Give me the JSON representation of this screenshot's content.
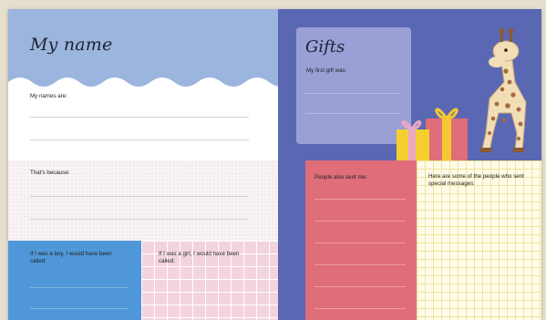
{
  "left_page": {
    "title": "My name",
    "names_label": "My names are:",
    "because_label": "That's because:",
    "boy_label": "If I was a boy, I would have been called:",
    "girl_label": "If I was a girl, I would have been called:"
  },
  "right_page": {
    "title": "Gifts",
    "first_gift_label": "My first gift was:",
    "also_sent_label": "People also sent me:",
    "messages_label": "Here are some of the people who sent special messages:"
  },
  "colors": {
    "header_blue": "#9bb5de",
    "right_bg": "#5a67b3",
    "card_lavender": "#9a9fd6",
    "pink_red": "#e06d7a",
    "blue_box": "#4f97d8",
    "grid_pink": "#f3d3dc",
    "grid_yellow": "#fffbe9"
  },
  "icons": [
    "giraffe-illustration",
    "gift-box-icon"
  ]
}
